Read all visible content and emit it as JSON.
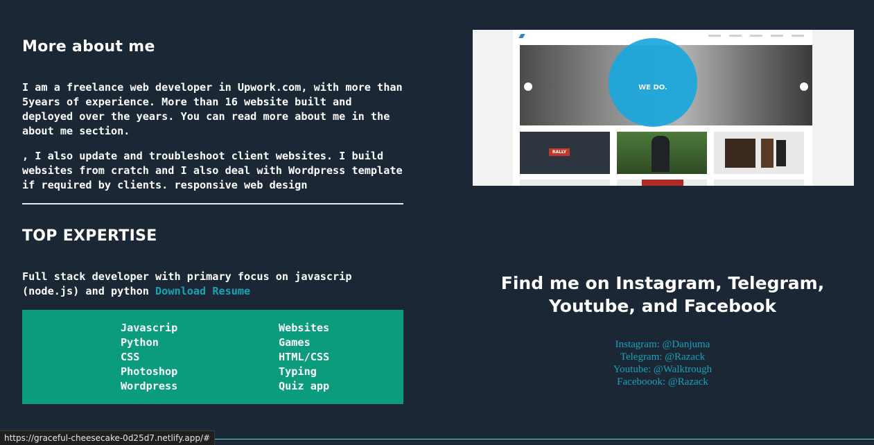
{
  "about": {
    "title": "More about me",
    "paragraph1": "I am a freelance web developer in Upwork.com, with more than 5years of experience. More than 16 website built and deployed over the years. You can read more about me in the about me section.",
    "paragraph2": ", I also update and troubleshoot client websites. I build websites from cratch and I also deal with Wordpress template if required by clients. responsive web design"
  },
  "expertise": {
    "title": "TOP EXPERTISE",
    "description": "Full stack developer with primary focus on javascrip (node.js) and python ",
    "resume_link": "Download Resume",
    "skills_left": [
      "Javascrip",
      "Python",
      "CSS",
      "Photoshop",
      "Wordpress"
    ],
    "skills_right": [
      "Websites",
      "Games",
      "HTML/CSS",
      "Typing",
      "Quiz app"
    ]
  },
  "preview": {
    "hero_text": "WE DO.",
    "tile_label": "RALLY"
  },
  "find": {
    "title": "Find me on Instagram, Telegram, Youtube, and Facebook",
    "instagram": "Instagram: @Danjuma",
    "telegram": "Telegram: @Razack",
    "youtube": "Youtube: @Walktrough",
    "facebook": "Faceboook: @Razack"
  },
  "status_bar": {
    "url": "https://graceful-cheesecake-0d25d7.netlify.app/#"
  },
  "colors": {
    "background": "#1b2734",
    "accent_link": "#17a2b8",
    "skills_box": "#0a9c7d"
  }
}
